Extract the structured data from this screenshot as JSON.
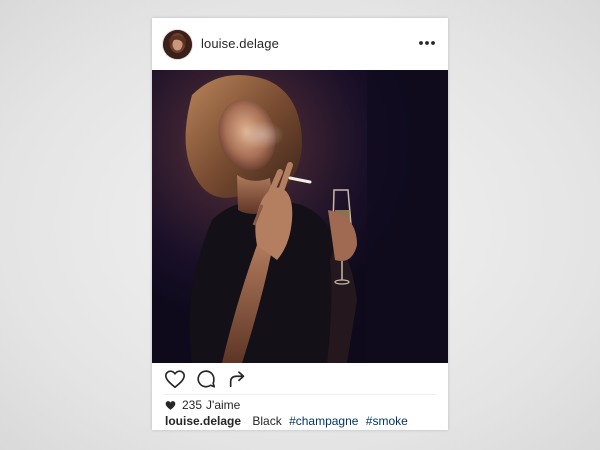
{
  "post": {
    "username": "louise.delage",
    "likes_count": "235",
    "likes_label": "J'aime",
    "caption": {
      "username": "louise.delage",
      "text": "Black",
      "hashtags": [
        "#champagne",
        "#smoke"
      ]
    }
  },
  "icons": {
    "more": "more-options-icon",
    "like": "heart-icon",
    "comment": "comment-icon",
    "share": "share-icon",
    "likes_heart": "heart-filled-icon"
  },
  "colors": {
    "background": "#e9e9e9",
    "card": "#ffffff",
    "text": "#262626",
    "hashtag": "#003569",
    "photo_dark": "#120c1a"
  }
}
